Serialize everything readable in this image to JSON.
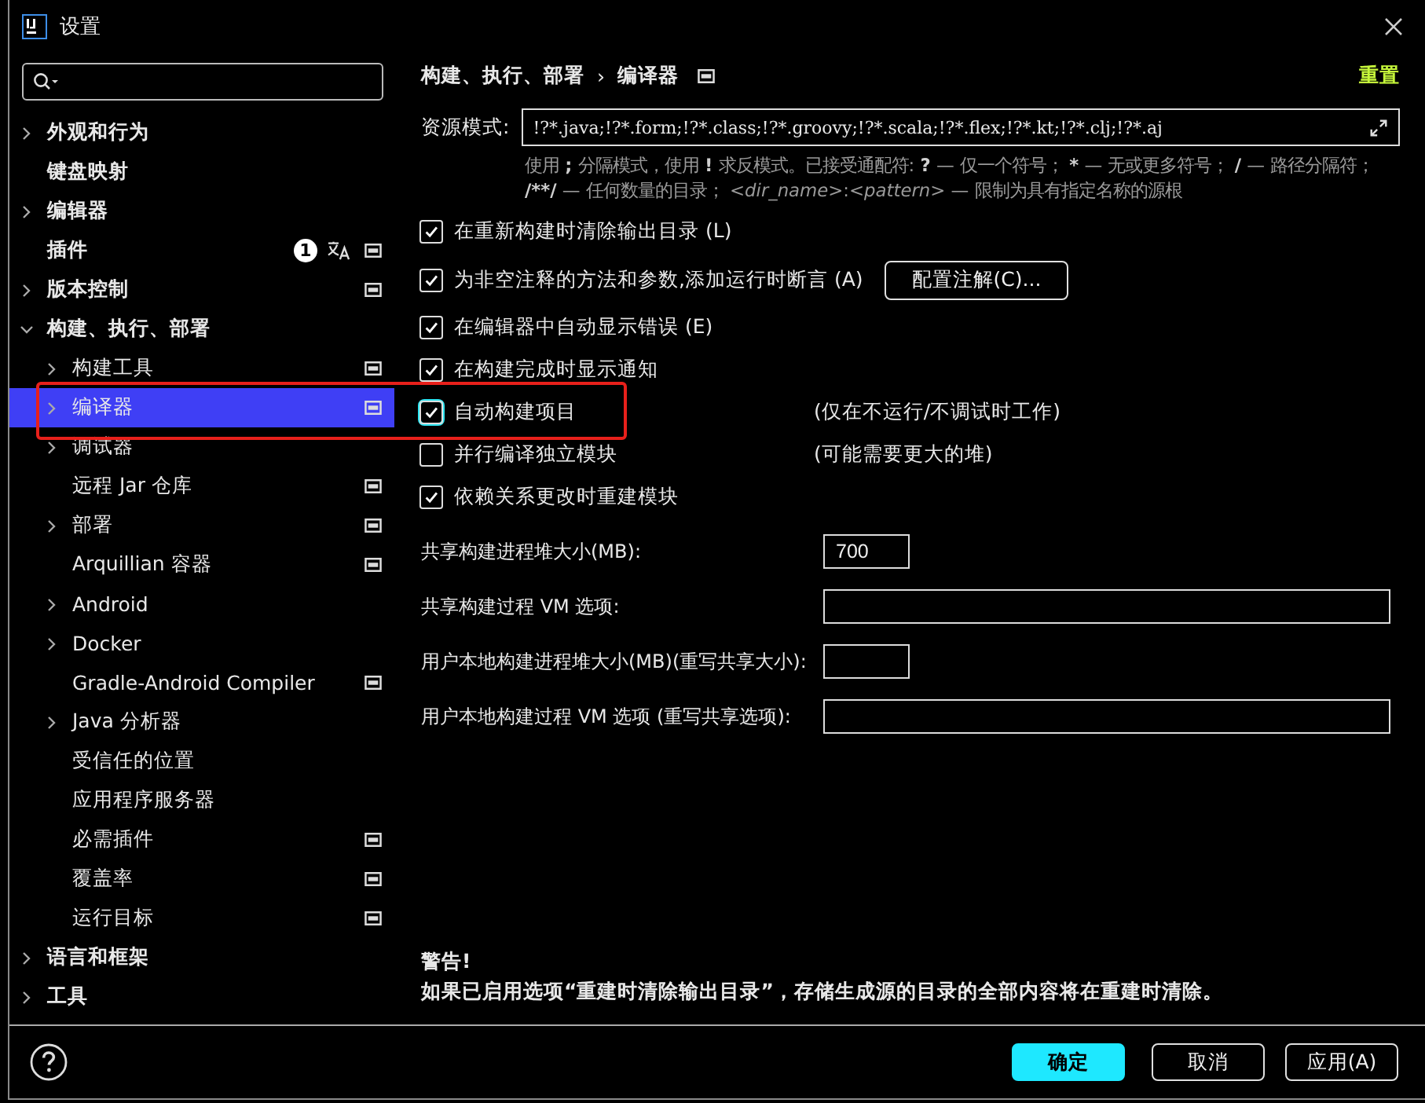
{
  "window": {
    "title": "设置"
  },
  "sidebar": {
    "items": [
      {
        "label": "外观和行为",
        "expanded": false,
        "has_children": true,
        "selected": false
      },
      {
        "label": "键盘映射",
        "has_children": false,
        "selected": false
      },
      {
        "label": "编辑器",
        "expanded": false,
        "has_children": true,
        "selected": false
      },
      {
        "label": "插件",
        "has_children": false,
        "selected": false,
        "badge": "1",
        "translate": true,
        "project": true
      },
      {
        "label": "版本控制",
        "expanded": false,
        "has_children": true,
        "selected": false,
        "project": true
      },
      {
        "label": "构建、执行、部署",
        "expanded": true,
        "has_children": true,
        "selected": false,
        "children": [
          {
            "label": "构建工具",
            "expanded": false,
            "has_children": true,
            "selected": false,
            "project": true
          },
          {
            "label": "编译器",
            "expanded": false,
            "has_children": true,
            "selected": true,
            "project": true
          },
          {
            "label": "调试器",
            "expanded": false,
            "has_children": true,
            "selected": false
          },
          {
            "label": "远程 Jar 仓库",
            "has_children": false,
            "selected": false,
            "project": true
          },
          {
            "label": "部署",
            "expanded": false,
            "has_children": true,
            "selected": false,
            "project": true
          },
          {
            "label": "Arquillian 容器",
            "has_children": false,
            "selected": false,
            "project": true
          },
          {
            "label": "Android",
            "expanded": false,
            "has_children": true,
            "selected": false
          },
          {
            "label": "Docker",
            "expanded": false,
            "has_children": true,
            "selected": false
          },
          {
            "label": "Gradle-Android Compiler",
            "has_children": false,
            "selected": false,
            "project": true
          },
          {
            "label": "Java 分析器",
            "expanded": false,
            "has_children": true,
            "selected": false
          },
          {
            "label": "受信任的位置",
            "has_children": false,
            "selected": false
          },
          {
            "label": "应用程序服务器",
            "has_children": false,
            "selected": false
          },
          {
            "label": "必需插件",
            "has_children": false,
            "selected": false,
            "project": true
          },
          {
            "label": "覆盖率",
            "has_children": false,
            "selected": false,
            "project": true
          },
          {
            "label": "运行目标",
            "has_children": false,
            "selected": false,
            "project": true
          }
        ]
      },
      {
        "label": "语言和框架",
        "expanded": false,
        "has_children": true,
        "selected": false
      },
      {
        "label": "工具",
        "expanded": false,
        "has_children": true,
        "selected": false
      }
    ]
  },
  "breadcrumb": {
    "parent": "构建、执行、部署",
    "separator": "›",
    "current": "编译器",
    "project": true
  },
  "reset_link": "重置",
  "resource_patterns": {
    "label": "资源模式:",
    "value": "!?*.java;!?*.form;!?*.class;!?*.groovy;!?*.scala;!?*.flex;!?*.kt;!?*.clj;!?*.aj",
    "hint": [
      {
        "kind": "plain",
        "text": "使用 "
      },
      {
        "kind": "bold",
        "text": ";"
      },
      {
        "kind": "plain",
        "text": " 分隔模式，使用 "
      },
      {
        "kind": "bold",
        "text": "!"
      },
      {
        "kind": "plain",
        "text": " 求反模式。已接受通配符: "
      },
      {
        "kind": "bold",
        "text": "?"
      },
      {
        "kind": "plain",
        "text": " — 仅一个符号； "
      },
      {
        "kind": "bold",
        "text": "*"
      },
      {
        "kind": "plain",
        "text": " — 无或更多符号； "
      },
      {
        "kind": "bold",
        "text": "/"
      },
      {
        "kind": "plain",
        "text": " — 路径分隔符； "
      },
      {
        "kind": "bold",
        "text": "/**/"
      },
      {
        "kind": "plain",
        "text": " — 任何数量的目录； "
      },
      {
        "kind": "italic",
        "text": "<dir_name>"
      },
      {
        "kind": "plain",
        "text": ":"
      },
      {
        "kind": "italic",
        "text": "<pattern>"
      },
      {
        "kind": "plain",
        "text": " — 限制为具有指定名称的源根"
      }
    ]
  },
  "options": [
    {
      "label": "在重新构建时清除输出目录 (L)",
      "checked": true,
      "focused": false
    },
    {
      "label": "为非空注释的方法和参数,添加运行时断言 (A)",
      "checked": true,
      "focused": false,
      "button": "配置注解(C)..."
    },
    {
      "label": "在编辑器中自动显示错误 (E)",
      "checked": true,
      "focused": false
    },
    {
      "label": "在构建完成时显示通知",
      "checked": true,
      "focused": false
    },
    {
      "label": "自动构建项目",
      "checked": true,
      "focused": true,
      "note": "(仅在不运行/不调试时工作)"
    },
    {
      "label": "并行编译独立模块",
      "checked": false,
      "focused": false,
      "note": "(可能需要更大的堆)"
    },
    {
      "label": "依赖关系更改时重建模块",
      "checked": true,
      "focused": false
    }
  ],
  "fields": [
    {
      "label": "共享构建进程堆大小(MB):",
      "value": "700",
      "kind": "short"
    },
    {
      "label": "共享构建过程 VM 选项:",
      "kind": "wide"
    },
    {
      "label": "用户本地构建进程堆大小(MB)(重写共享大小):",
      "kind": "short"
    },
    {
      "label": "用户本地构建过程 VM 选项 (重写共享选项):",
      "kind": "wide"
    }
  ],
  "warning": {
    "title": "警告!",
    "text": "如果已启用选项“重建时清除输出目录”，存储生成源的目录的全部内容将在重建时清除。"
  },
  "buttons": [
    {
      "label": "确定",
      "kind": "primary"
    },
    {
      "label": "取消",
      "kind": "normal"
    },
    {
      "label": "应用(A)",
      "kind": "normal"
    }
  ]
}
